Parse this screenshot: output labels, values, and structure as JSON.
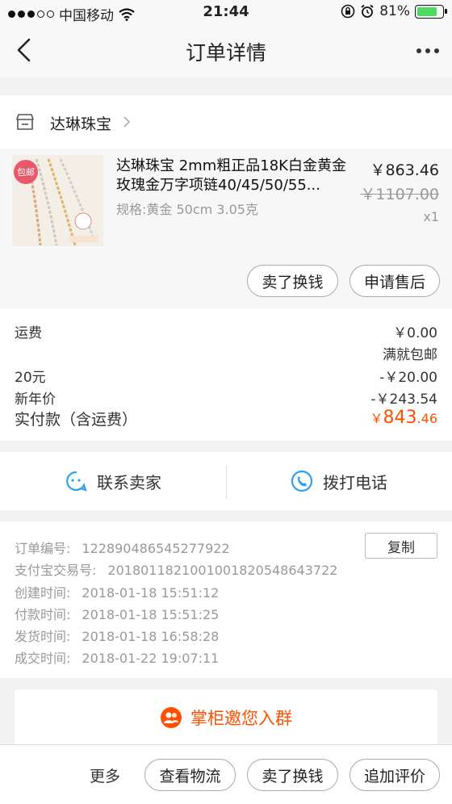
{
  "status_bar": {
    "carrier": "中国移动",
    "time": "21:44",
    "battery": "81%",
    "battery_level": 0.81,
    "icons": [
      "signal-dots-icon",
      "wifi-icon",
      "orientation-lock-icon",
      "alarm-icon",
      "battery-icon"
    ]
  },
  "nav": {
    "title": "订单详情"
  },
  "shop": {
    "name": "达琳珠宝"
  },
  "product": {
    "badge": "包邮",
    "title": "达琳珠宝 2mm粗正品18K白金黄金玫瑰金万字项链40/45/50/55...",
    "spec": "规格:黄金 50cm 3.05克",
    "price": "￥863.46",
    "original_price": "￥1107.00",
    "quantity": "x1",
    "sell_button": "卖了换钱",
    "after_sale_button": "申请售后"
  },
  "fees": {
    "shipping_label": "运费",
    "shipping_value": "￥0.00",
    "shipping_note": "满就包邮",
    "coupon_label": "20元",
    "coupon_value": "-￥20.00",
    "newyear_label": "新年价",
    "newyear_value": "-￥243.54",
    "paid_label": "实付款（含运费）",
    "paid_currency": "￥",
    "paid_integer": "843",
    "paid_decimal": ".46"
  },
  "contact": {
    "seller_label": "联系卖家",
    "call_label": "拨打电话"
  },
  "order_info": {
    "order_no_label": "订单编号:",
    "order_no": "122890486545277922",
    "copy_button": "复制",
    "alipay_label": "支付宝交易号:",
    "alipay_no": "2018011821001001820548643722",
    "created_label": "创建时间:",
    "created": "2018-01-18 15:51:12",
    "paid_label": "付款时间:",
    "paid": "2018-01-18 15:51:25",
    "shipped_label": "发货时间:",
    "shipped": "2018-01-18 16:58:28",
    "completed_label": "成交时间:",
    "completed": "2018-01-22 19:07:11"
  },
  "group_banner": {
    "text": "掌柜邀您入群"
  },
  "bottom_bar": {
    "more": "更多",
    "logistics": "查看物流",
    "sell": "卖了换钱",
    "review": "追加评价"
  },
  "colors": {
    "accent": "#ff5000",
    "contact_blue": "#29a1f7"
  }
}
